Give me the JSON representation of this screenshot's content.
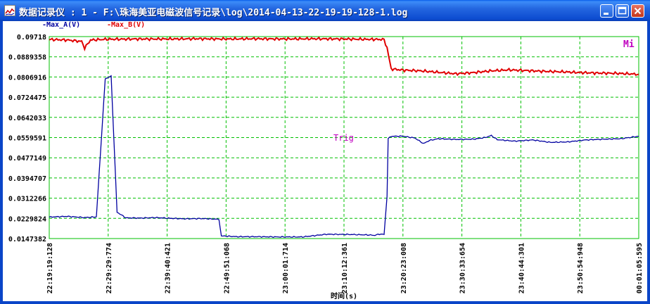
{
  "window": {
    "title": "数据记录仪 : 1 - F:\\珠海美亚电磁波信号记录\\log\\2014-04-13-22-19-19-128-1.log"
  },
  "legend": {
    "a": "-Max_A(V)",
    "b": "-Max_B(V)"
  },
  "markers": {
    "mi": "Mi",
    "trig": "Trig"
  },
  "colors": {
    "series_a": "#0000A0",
    "series_b": "#E00000",
    "grid": "#00C000",
    "marker": "#C000C0"
  },
  "chart_data": {
    "type": "line",
    "xlabel": "时间(s)",
    "ylabel": "",
    "y_ticks": [
      "0.09718",
      "0.0889358",
      "0.0806916",
      "0.0724475",
      "0.0642033",
      "0.0559591",
      "0.0477149",
      "0.0394707",
      "0.0312266",
      "0.0229824",
      "0.0147382"
    ],
    "x_ticks": [
      "22:19:19:128",
      "22:29:29:774",
      "22:39:40:421",
      "22:49:51:068",
      "23:00:01:714",
      "23:10:12:361",
      "23:20:23:008",
      "23:30:33:654",
      "23:40:44:301",
      "23:50:54:948",
      "00:01:05:595"
    ],
    "ylim": [
      0.0147382,
      0.09718
    ],
    "series": [
      {
        "name": "-Max_A(V)",
        "x": [
          0,
          0.3,
          0.6,
          0.8,
          0.95,
          1.05,
          1.15,
          1.3,
          1.55,
          1.8,
          2.05,
          2.3,
          2.6,
          2.88,
          2.92,
          3.2,
          3.5,
          3.9,
          4.3,
          4.7,
          5.1,
          5.45,
          5.5,
          5.6,
          5.68,
          5.73,
          5.75,
          5.8,
          6.0,
          6.2,
          6.35,
          6.45,
          6.6,
          6.9,
          7.2,
          7.4,
          7.5,
          7.6,
          7.9,
          8.2,
          8.5,
          8.8,
          9.1,
          9.4,
          9.7,
          10.0
        ],
        "y": [
          0.0235,
          0.0238,
          0.0233,
          0.0236,
          0.08,
          0.081,
          0.0255,
          0.0232,
          0.0231,
          0.0233,
          0.023,
          0.0228,
          0.0229,
          0.0226,
          0.0158,
          0.0155,
          0.0155,
          0.0154,
          0.0154,
          0.0165,
          0.0164,
          0.0162,
          0.016,
          0.0165,
          0.0165,
          0.032,
          0.0555,
          0.0565,
          0.0565,
          0.0558,
          0.0535,
          0.0548,
          0.0555,
          0.0552,
          0.0553,
          0.056,
          0.0568,
          0.0551,
          0.0545,
          0.055,
          0.054,
          0.0542,
          0.055,
          0.0553,
          0.0555,
          0.0565
        ]
      },
      {
        "name": "-Max_B(V)",
        "x": [
          0,
          0.3,
          0.55,
          0.6,
          0.7,
          1.0,
          1.5,
          2.0,
          2.5,
          3.0,
          3.5,
          4.0,
          4.5,
          5.0,
          5.3,
          5.68,
          5.73,
          5.8,
          6.0,
          6.3,
          6.6,
          6.9,
          7.2,
          7.5,
          7.8,
          8.1,
          8.4,
          8.7,
          9.0,
          9.3,
          9.6,
          10.0
        ],
        "y": [
          0.096,
          0.0958,
          0.0952,
          0.0925,
          0.0958,
          0.0961,
          0.0962,
          0.0962,
          0.0963,
          0.0962,
          0.0963,
          0.0962,
          0.0963,
          0.0962,
          0.0961,
          0.096,
          0.0925,
          0.084,
          0.0835,
          0.0832,
          0.0826,
          0.082,
          0.0825,
          0.0832,
          0.0836,
          0.0833,
          0.083,
          0.0828,
          0.0825,
          0.0823,
          0.0822,
          0.0818
        ]
      }
    ]
  }
}
